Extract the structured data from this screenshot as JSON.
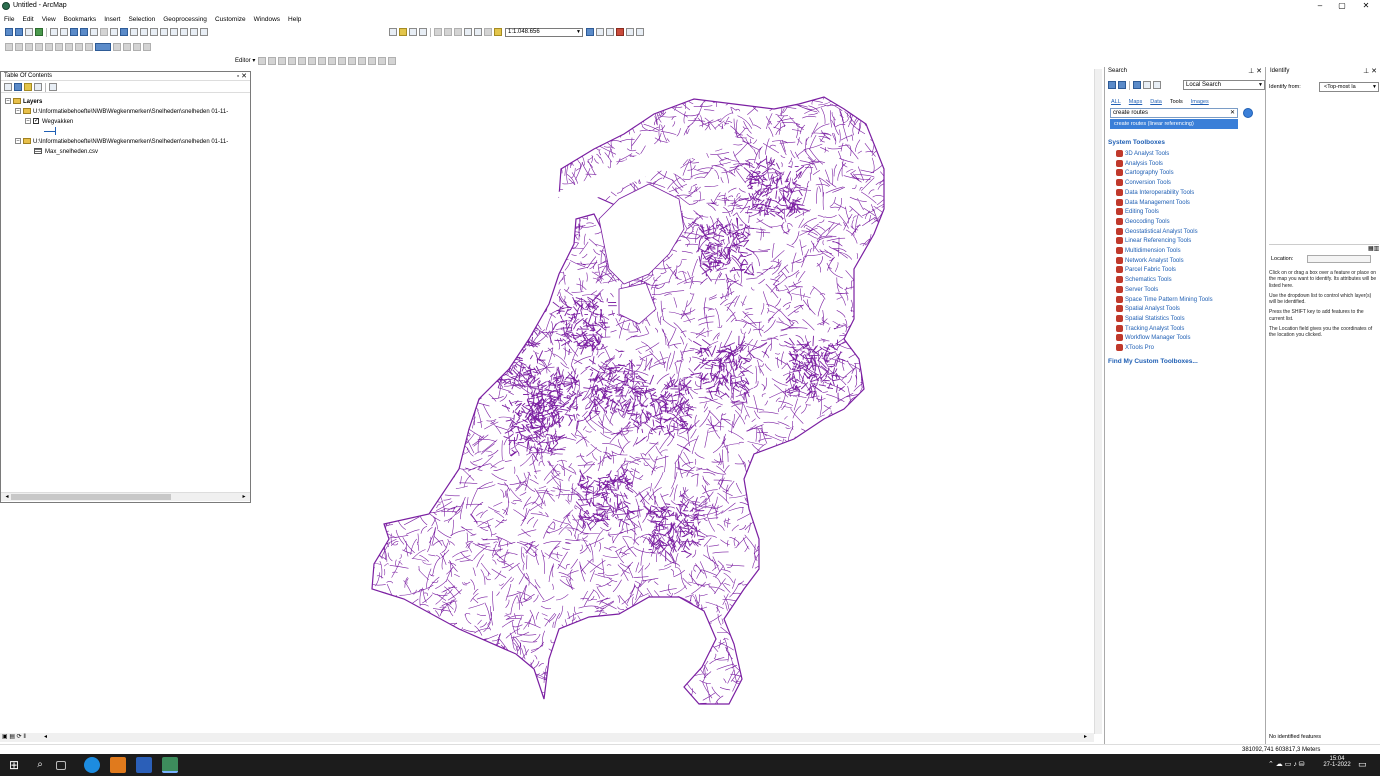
{
  "window": {
    "title": "Untitled - ArcMap"
  },
  "menu": [
    "File",
    "Edit",
    "View",
    "Bookmarks",
    "Insert",
    "Selection",
    "Geoprocessing",
    "Customize",
    "Windows",
    "Help"
  ],
  "toolbar": {
    "scale": "1:1.048.656",
    "editor_label": "Editor ▾"
  },
  "toc": {
    "title": "Table Of Contents",
    "root": "Layers",
    "items": [
      {
        "label": "U:\\Informatiebehoefte\\NWB\\Wegkenmerken\\Snelheden\\snelheden 01-11-"
      },
      {
        "label": "Wegvakken"
      },
      {
        "label": "U:\\Informatiebehoefte\\NWB\\Wegkenmerken\\Snelheden\\snelheden 01-11-"
      },
      {
        "label": "Max_snelheden.csv"
      }
    ]
  },
  "search": {
    "title": "Search",
    "scope": "Local Search",
    "categories": [
      "ALL",
      "Maps",
      "Data",
      "Tools",
      "Images"
    ],
    "query": "create routes",
    "suggestion": "create routes (linear referencing)",
    "system_toolboxes_label": "System Toolboxes",
    "toolboxes": [
      "3D Analyst Tools",
      "Analysis Tools",
      "Cartography Tools",
      "Conversion Tools",
      "Data Interoperability Tools",
      "Data Management Tools",
      "Editing Tools",
      "Geocoding Tools",
      "Geostatistical Analyst Tools",
      "Linear Referencing Tools",
      "Multidimension Tools",
      "Network Analyst Tools",
      "Parcel Fabric Tools",
      "Schematics Tools",
      "Server Tools",
      "Space Time Pattern Mining Tools",
      "Spatial Analyst Tools",
      "Spatial Statistics Tools",
      "Tracking Analyst Tools",
      "Workflow Manager Tools",
      "XTools Pro"
    ],
    "find_custom": "Find My Custom Toolboxes..."
  },
  "identify": {
    "title": "Identify",
    "from_label": "Identify from:",
    "from_value": "<Top-most la",
    "location_label": "Location:",
    "help": [
      "Click on or drag a box over a feature or place on the map you want to identify. Its attributes will be listed here.",
      "Use the dropdown list to control which layer(s) will be identified.",
      "Press the SHIFT key to add features to the current list.",
      "The Location field gives you the coordinates of the location you clicked."
    ],
    "no_features": "No identified features"
  },
  "status": {
    "coords": "381092,741  603817,3 Meters"
  },
  "taskbar": {
    "time": "15:04",
    "date": "27-1-2022"
  },
  "colors": {
    "map_roads": "#7b1fa2",
    "link": "#1f5fb4",
    "selection": "#3a7fd8"
  }
}
